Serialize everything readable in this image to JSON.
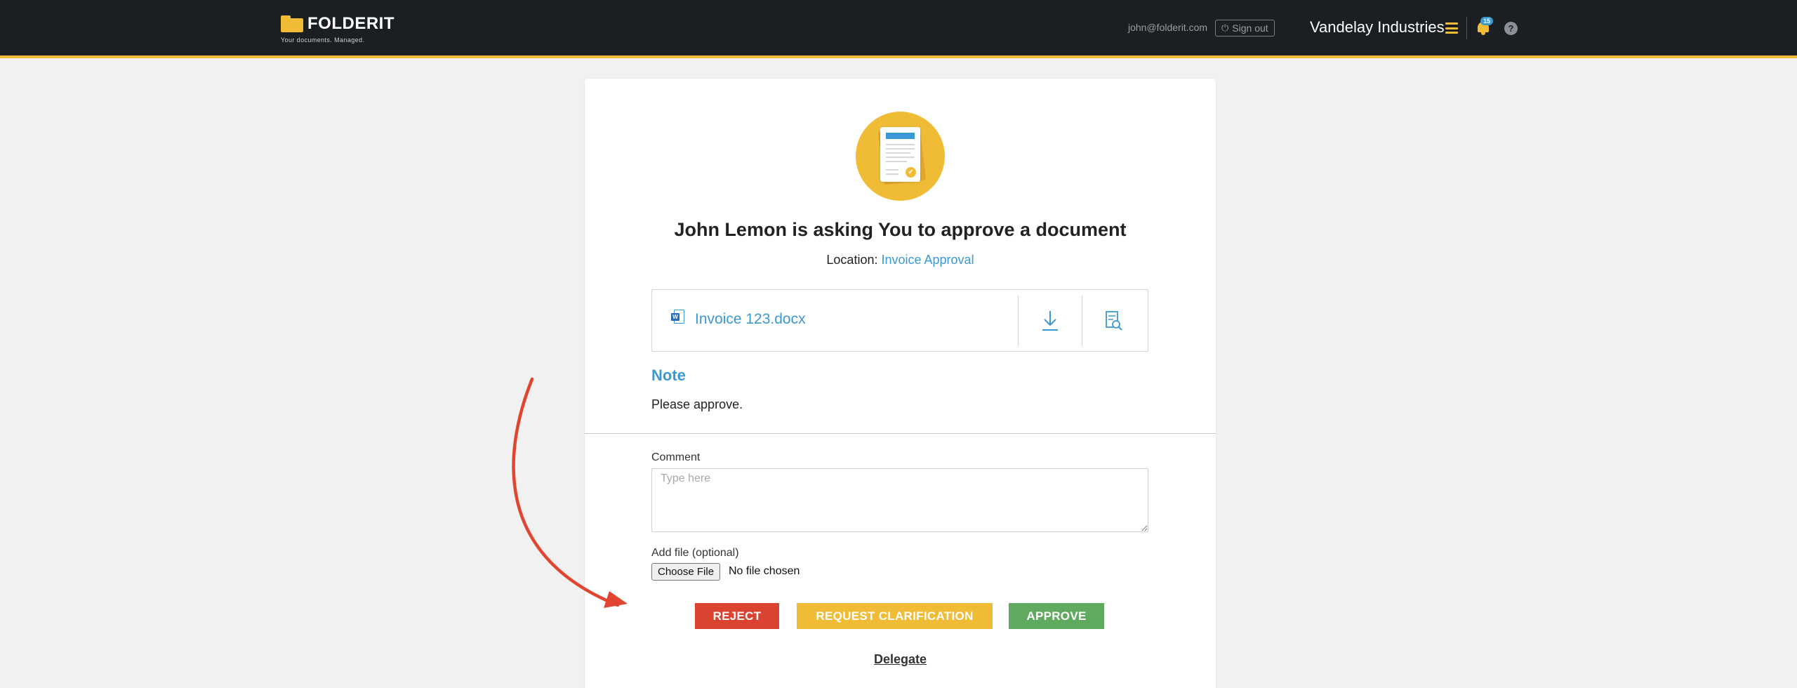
{
  "header": {
    "logo_text": "FOLDERIT",
    "tagline": "Your documents. Managed.",
    "user_email": "john@folderit.com",
    "signout_label": "Sign out",
    "company": "Vandelay Industries",
    "notification_count": "15",
    "help_label": "?"
  },
  "request": {
    "title": "John Lemon is asking You to approve a document",
    "location_label": "Location:",
    "location_link": "Invoice Approval",
    "file_name": "Invoice 123.docx",
    "note_title": "Note",
    "note_text": "Please approve."
  },
  "form": {
    "comment_label": "Comment",
    "comment_placeholder": "Type here",
    "addfile_label": "Add file (optional)",
    "choose_file_label": "Choose File",
    "no_file_text": "No file chosen"
  },
  "actions": {
    "reject_label": "REJECT",
    "clarify_label": "REQUEST CLARIFICATION",
    "approve_label": "APPROVE",
    "delegate_label": "Delegate"
  },
  "colors": {
    "accent_yellow": "#f0bc35",
    "link_blue": "#3a98d4",
    "reject_red": "#d9432f",
    "approve_green": "#5faa5f",
    "topbar_dark": "#1b1e22"
  },
  "icons": [
    "folder-icon",
    "power-icon",
    "menu-icon",
    "bell-icon",
    "help-icon",
    "document-icon",
    "word-file-icon",
    "download-icon",
    "preview-icon",
    "arrow-annotation"
  ]
}
